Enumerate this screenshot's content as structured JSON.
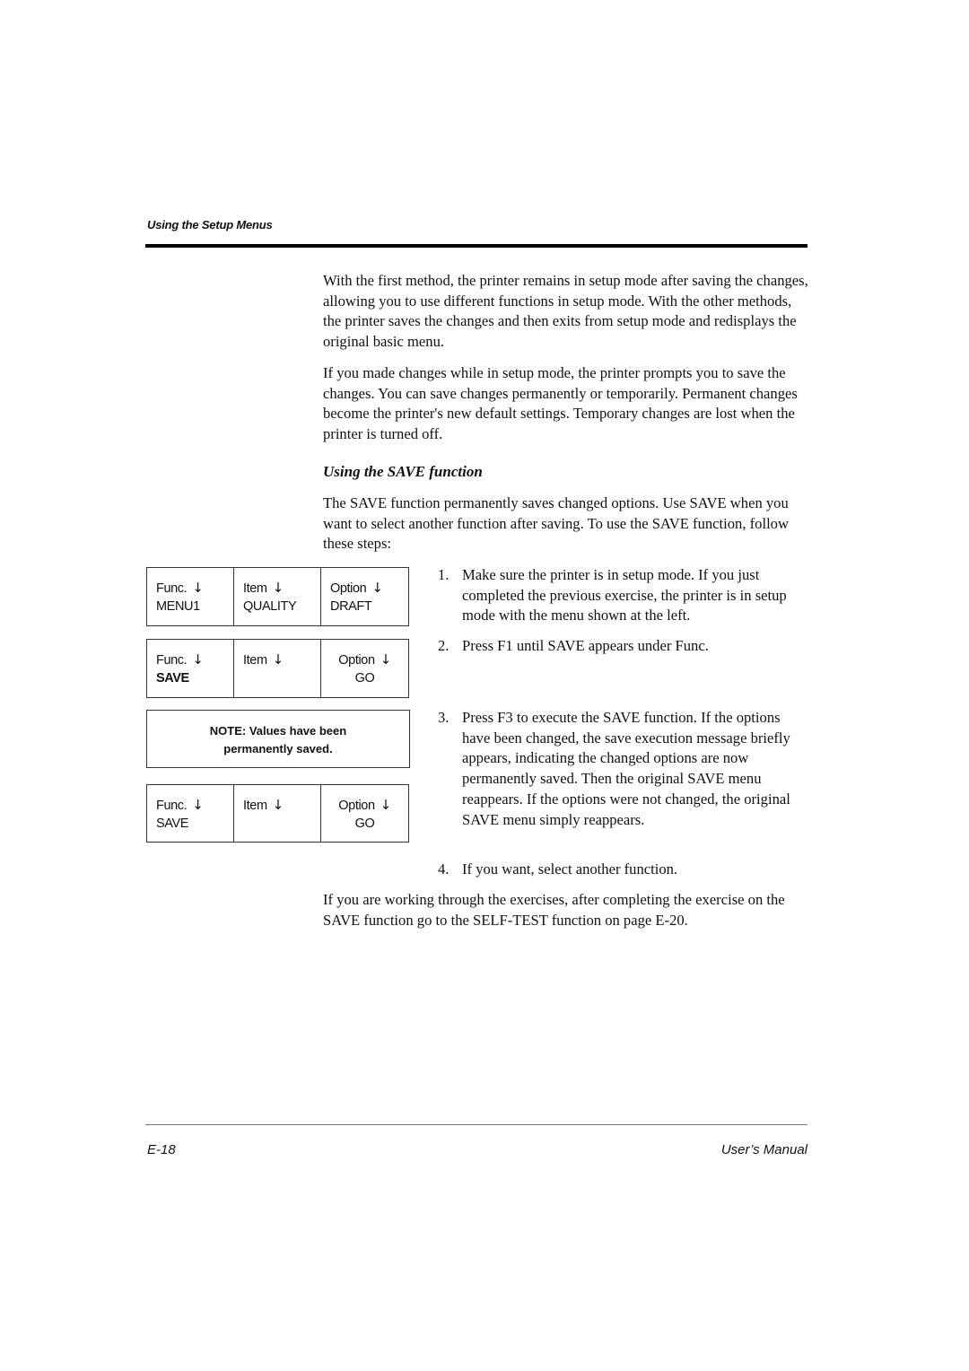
{
  "header": {
    "running_head": "Using the Setup Menus"
  },
  "body": {
    "paragraph_1": "With the first method, the printer remains in setup mode after saving the changes, allowing you to use different functions in setup mode. With the other methods, the printer saves the changes and then exits from setup mode and redisplays the original basic menu.",
    "paragraph_2": "If you made changes while in setup mode, the printer prompts you to save the changes. You can save changes permanently or temporarily. Permanent changes become the printer's new default settings. Temporary changes are lost when the printer is turned off.",
    "subheading": "Using the SAVE function",
    "paragraph_3": "The SAVE function permanently saves changed options. Use SAVE when you want to select another function after saving. To use the SAVE function, follow these steps:",
    "steps": [
      {
        "num": "1.",
        "text": "Make sure the printer is in setup mode. If you just completed the previous exercise, the printer is in setup mode with the menu shown at the left."
      },
      {
        "num": "2.",
        "text": "Press F1 until SAVE appears under Func."
      },
      {
        "num": "3.",
        "text": "Press F3 to execute the SAVE function. If the options have been changed, the save execution message briefly appears, indicating the changed options are now permanently saved. Then the original SAVE menu reappears. If the options were not changed, the original SAVE menu simply reappears."
      },
      {
        "num": "4.",
        "text": "If you want, select another function."
      }
    ],
    "paragraph_4": "If you are working through the exercises, after completing the exercise on the SAVE function go to the SELF-TEST function on page E-20."
  },
  "lcd_panels": [
    {
      "func_label": "Func.",
      "func_value": "MENU1",
      "item_label": "Item",
      "item_value": "QUALITY",
      "option_label": "Option",
      "option_value": "DRAFT"
    },
    {
      "func_label": "Func.",
      "func_value": "SAVE",
      "item_label": "Item",
      "item_value": "",
      "option_label": "Option",
      "option_value": "GO"
    },
    {
      "func_label": "Func.",
      "func_value": "SAVE",
      "item_label": "Item",
      "item_value": "",
      "option_label": "Option",
      "option_value": "GO"
    }
  ],
  "note_box": {
    "line_1": "NOTE: Values have been",
    "line_2": "permanently saved."
  },
  "icons": {
    "down_arrow": "↓"
  },
  "footer": {
    "page_number": "E-18",
    "manual_title": "User’s Manual"
  }
}
